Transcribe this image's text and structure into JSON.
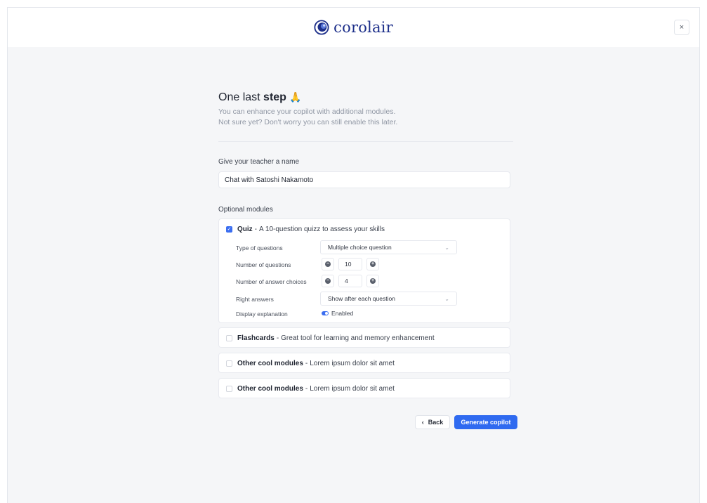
{
  "header": {
    "brand": "corolair",
    "close_label": "×"
  },
  "intro": {
    "title_prefix": "One last",
    "title_bold": "step",
    "title_emoji": "🙏",
    "subtitle_line1": "You can enhance your copilot with additional modules.",
    "subtitle_line2": "Not sure yet? Don't worry you can still enable this later."
  },
  "name_field": {
    "label": "Give your teacher a name",
    "value": "Chat with Satoshi Nakamoto"
  },
  "modules": {
    "section_label": "Optional modules",
    "quiz": {
      "checked": true,
      "name": "Quiz",
      "description": "A 10-question quizz to assess your skills",
      "options": {
        "type_label": "Type of questions",
        "type_value": "Multiple choice question",
        "num_questions_label": "Number of questions",
        "num_questions_value": "10",
        "num_choices_label": "Number of answer choices",
        "num_choices_value": "4",
        "right_answers_label": "Right answers",
        "right_answers_value": "Show after each question",
        "explanation_label": "Display explanation",
        "explanation_value": "Enabled"
      }
    },
    "flashcards": {
      "checked": false,
      "name": "Flashcards",
      "description": "Great tool for learning and memory enhancement"
    },
    "other1": {
      "checked": false,
      "name": "Other cool modules",
      "description": "Lorem ipsum dolor sit amet"
    },
    "other2": {
      "checked": false,
      "name": "Other cool modules",
      "description": "Lorem ipsum dolor sit amet"
    }
  },
  "actions": {
    "back_icon": "‹",
    "back_label": "Back",
    "generate_label": "Generate copilot"
  },
  "colors": {
    "accent": "#2f6af0",
    "brand": "#1d2f8a",
    "background": "#f5f6f8"
  },
  "icons": {
    "chevron": "⌄",
    "minus": "−",
    "plus": "+",
    "check": "✓"
  }
}
